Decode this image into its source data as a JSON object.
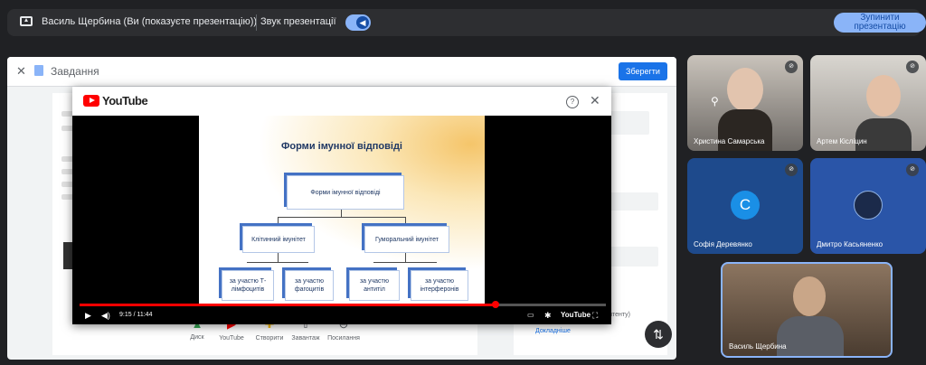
{
  "topbar": {
    "presenting_text": "Василь Щербина (Ви (показуєте презентацію))",
    "sound_label": "Звук презентації",
    "stop_button": "Зупинити презентацію"
  },
  "doc": {
    "title": "Завдання",
    "save_label": "Зберегти",
    "close_glyph": "✕",
    "attachments": [
      {
        "label": "Диск",
        "icon": "drive-icon"
      },
      {
        "label": "YouTube",
        "icon": "youtube-icon"
      },
      {
        "label": "Створити",
        "icon": "plus-icon"
      },
      {
        "label": "Завантаж",
        "icon": "upload-icon"
      },
      {
        "label": "Посилання",
        "icon": "link-icon"
      }
    ],
    "side_text": "плагіат (оригінальність контенту)",
    "side_link": "Докладніше"
  },
  "youtube": {
    "logo_text": "YouTube",
    "help_glyph": "?",
    "close_glyph": "✕",
    "time": "9:15 / 11:44",
    "progress_fraction": 0.79,
    "watermark": "YouTube",
    "slide": {
      "title": "Форми імунної відповіді",
      "root": "Форми імунної відповіді",
      "left": "Клітинний імунітет",
      "right": "Гуморальний імунітет",
      "leaf1": "за участю Т-лімфоцитів",
      "leaf2": "за участю фагоцитів",
      "leaf3": "за участю антитіл",
      "leaf4": "за участю інтерферонів"
    }
  },
  "participants": [
    {
      "name": "Христина Самарська",
      "muted": true
    },
    {
      "name": "Артем Кісліцин",
      "muted": true
    },
    {
      "name": "Софія Деревянко",
      "initial": "C",
      "muted": true
    },
    {
      "name": "Дмитро Касьяненко",
      "muted": true
    },
    {
      "name": "Василь Щербина",
      "muted": false
    }
  ],
  "colors": {
    "accent": "#8ab4f8",
    "youtube_red": "#ff0000",
    "tile_blue": "#1e4a8c"
  }
}
